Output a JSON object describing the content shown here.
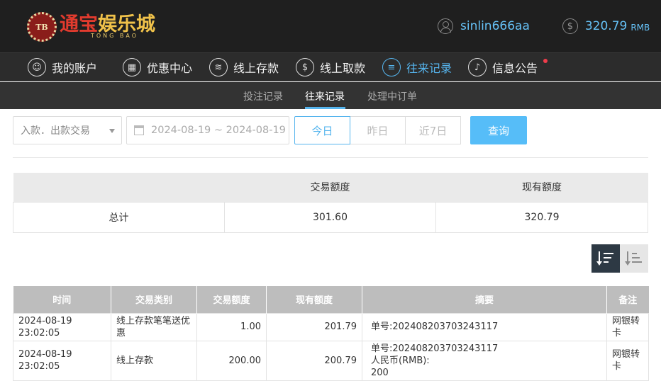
{
  "brand": {
    "badge": "TB",
    "name_part1": "通宝",
    "name_part2": "娱乐城",
    "name_en": "TONG BAO"
  },
  "user": {
    "username": "sinlin666aa",
    "balance": "320.79",
    "currency": "RMB"
  },
  "nav": {
    "items": [
      {
        "label": "我的账户",
        "icon": "user-icon"
      },
      {
        "label": "优惠中心",
        "icon": "gift-icon"
      },
      {
        "label": "线上存款",
        "icon": "deposit-icon"
      },
      {
        "label": "线上取款",
        "icon": "withdraw-icon"
      },
      {
        "label": "往来记录",
        "icon": "records-icon"
      },
      {
        "label": "信息公告",
        "icon": "bell-icon"
      }
    ],
    "active": "往来记录"
  },
  "subnav": {
    "items": [
      "投注记录",
      "往来记录",
      "处理中订单"
    ],
    "active": "往来记录"
  },
  "filters": {
    "type_select": "入款．出款交易",
    "date_range": "2024-08-19 ~ 2024-08-19",
    "day_buttons": [
      "今日",
      "昨日",
      "近7日"
    ],
    "active_day": "今日",
    "query_label": "查询"
  },
  "summary": {
    "headers": [
      "",
      "交易额度",
      "现有额度"
    ],
    "row": {
      "label": "总计",
      "transaction": "301.60",
      "current": "320.79"
    }
  },
  "records": {
    "headers": [
      "时间",
      "交易类别",
      "交易额度",
      "现有额度",
      "摘要",
      "备注"
    ],
    "rows": [
      {
        "time": "2024-08-19 23:02:05",
        "category": "线上存款笔笔送优惠",
        "amount": "1.00",
        "balance": "201.79",
        "summary_line1": "单号:202408203703243117",
        "summary_line2": "",
        "summary_line3": "",
        "note": "网银转卡"
      },
      {
        "time": "2024-08-19 23:02:05",
        "category": "线上存款",
        "amount": "200.00",
        "balance": "200.79",
        "summary_line1": "单号:202408203703243117",
        "summary_line2": "人民币(RMB):",
        "summary_line3": "200",
        "note": "网银转卡"
      }
    ]
  },
  "colors": {
    "accent": "#56b5ee",
    "header_bg": "#1f1f1f",
    "nav_bg": "#2c2c2c",
    "subnav_bg": "#333333",
    "notify_dot": "#f03c4b"
  }
}
